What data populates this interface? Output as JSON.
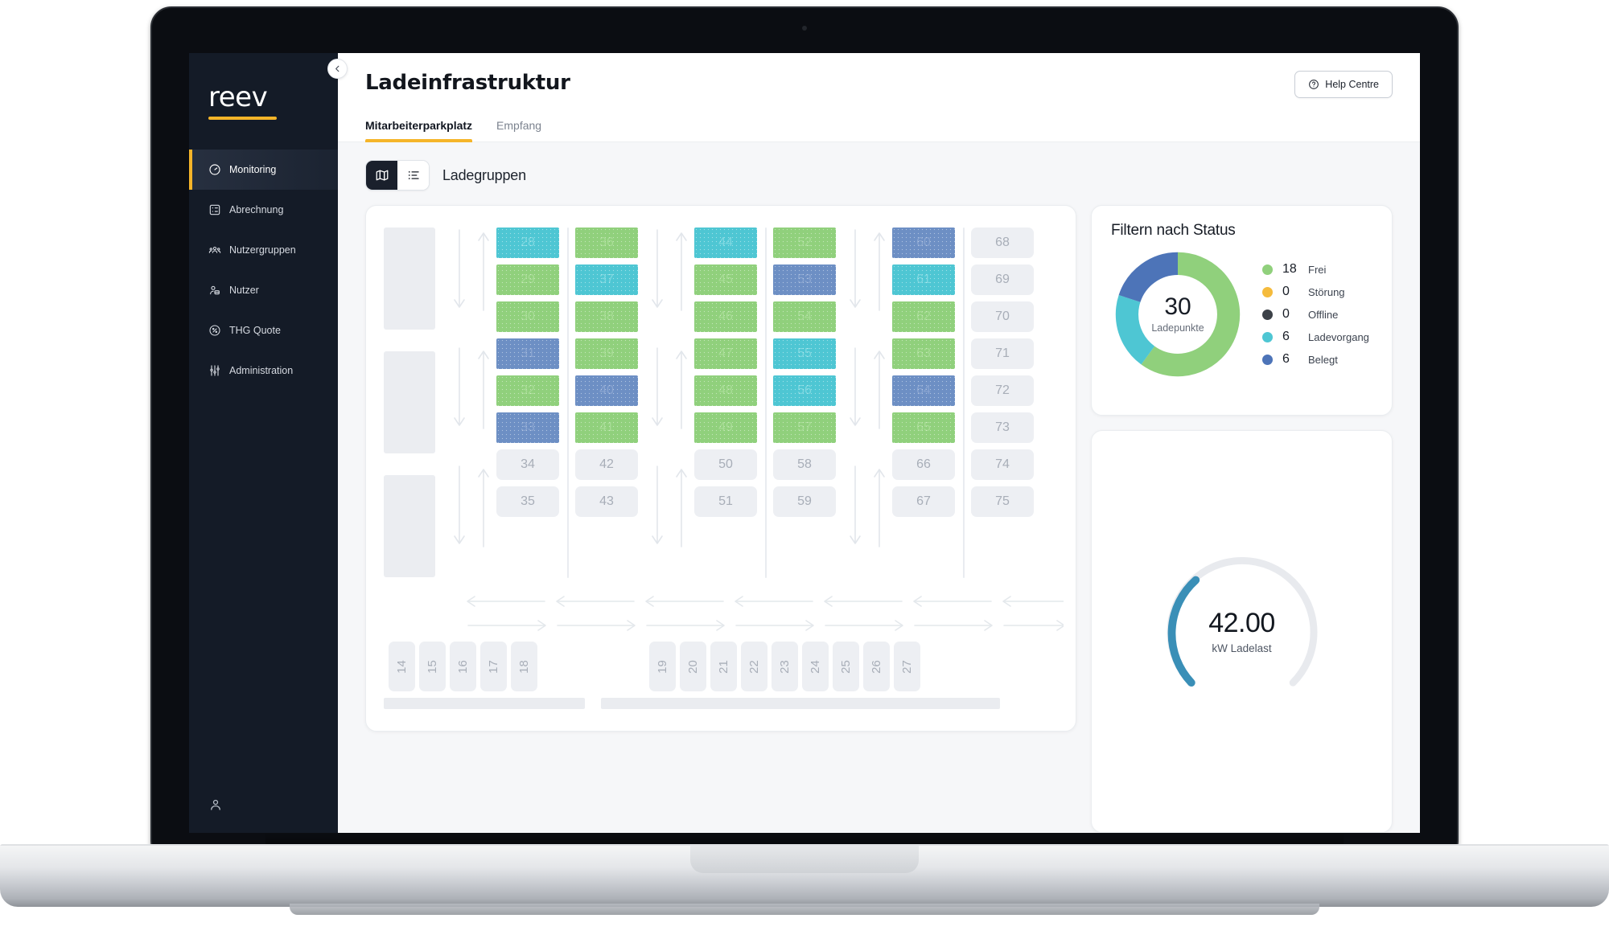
{
  "brand": {
    "wordmark": "reev"
  },
  "sidebar": {
    "items": [
      {
        "label": "Monitoring",
        "icon": "gauge-icon",
        "active": true
      },
      {
        "label": "Abrechnung",
        "icon": "receipt-icon",
        "active": false
      },
      {
        "label": "Nutzergruppen",
        "icon": "users-icon",
        "active": false
      },
      {
        "label": "Nutzer",
        "icon": "user-icon",
        "active": false
      },
      {
        "label": "THG Quote",
        "icon": "percent-icon",
        "active": false
      },
      {
        "label": "Administration",
        "icon": "sliders-icon",
        "active": false
      }
    ],
    "account_icon": "user-account-icon"
  },
  "header": {
    "title": "Ladeinfrastruktur",
    "help_label": "Help Centre",
    "help_icon": "question-circle-icon",
    "collapse_icon": "chevron-left-icon"
  },
  "tabs": [
    {
      "label": "Mitarbeiterparkplatz",
      "active": true
    },
    {
      "label": "Empfang",
      "active": false
    }
  ],
  "toolbar": {
    "title": "Ladegruppen",
    "views": [
      {
        "name": "map-view",
        "icon": "map-icon",
        "active": true
      },
      {
        "name": "list-view",
        "icon": "list-icon",
        "active": false
      }
    ]
  },
  "colors": {
    "free": "#90d07c",
    "stoerung": "#f5bb3c",
    "offline": "#3c4148",
    "charging": "#4ec6d3",
    "occupied": "#4d74b8",
    "empty": "#edeff3",
    "accent": "#f5b529",
    "gauge": "#3a8fb7",
    "gauge_track": "#e8eaee"
  },
  "map": {
    "slot_columns": [
      {
        "x": 162,
        "slots": [
          {
            "id": "28",
            "state": "charging"
          },
          {
            "id": "29",
            "state": "free"
          },
          {
            "id": "30",
            "state": "free"
          },
          {
            "id": "31",
            "state": "occupied"
          },
          {
            "id": "32",
            "state": "free"
          },
          {
            "id": "33",
            "state": "occupied"
          },
          {
            "id": "34",
            "state": "empty"
          },
          {
            "id": "35",
            "state": "empty"
          }
        ]
      },
      {
        "x": 260,
        "slots": [
          {
            "id": "36",
            "state": "free"
          },
          {
            "id": "37",
            "state": "charging"
          },
          {
            "id": "38",
            "state": "free"
          },
          {
            "id": "39",
            "state": "free"
          },
          {
            "id": "40",
            "state": "occupied"
          },
          {
            "id": "41",
            "state": "free"
          },
          {
            "id": "42",
            "state": "empty"
          },
          {
            "id": "43",
            "state": "empty"
          }
        ]
      },
      {
        "x": 408,
        "slots": [
          {
            "id": "44",
            "state": "charging"
          },
          {
            "id": "45",
            "state": "free"
          },
          {
            "id": "46",
            "state": "free"
          },
          {
            "id": "47",
            "state": "free"
          },
          {
            "id": "48",
            "state": "free"
          },
          {
            "id": "49",
            "state": "free"
          },
          {
            "id": "50",
            "state": "empty"
          },
          {
            "id": "51",
            "state": "empty"
          }
        ]
      },
      {
        "x": 506,
        "slots": [
          {
            "id": "52",
            "state": "free"
          },
          {
            "id": "53",
            "state": "occupied"
          },
          {
            "id": "54",
            "state": "free"
          },
          {
            "id": "55",
            "state": "charging"
          },
          {
            "id": "56",
            "state": "charging"
          },
          {
            "id": "57",
            "state": "free"
          },
          {
            "id": "58",
            "state": "empty"
          },
          {
            "id": "59",
            "state": "empty"
          }
        ]
      },
      {
        "x": 654,
        "slots": [
          {
            "id": "60",
            "state": "occupied"
          },
          {
            "id": "61",
            "state": "charging"
          },
          {
            "id": "62",
            "state": "free"
          },
          {
            "id": "63",
            "state": "free"
          },
          {
            "id": "64",
            "state": "occupied"
          },
          {
            "id": "65",
            "state": "free"
          },
          {
            "id": "66",
            "state": "empty"
          },
          {
            "id": "67",
            "state": "empty"
          }
        ]
      },
      {
        "x": 752,
        "slots": [
          {
            "id": "68",
            "state": "empty"
          },
          {
            "id": "69",
            "state": "empty"
          },
          {
            "id": "70",
            "state": "empty"
          },
          {
            "id": "71",
            "state": "empty"
          },
          {
            "id": "72",
            "state": "empty"
          },
          {
            "id": "73",
            "state": "empty"
          },
          {
            "id": "74",
            "state": "empty"
          },
          {
            "id": "75",
            "state": "empty"
          }
        ]
      }
    ],
    "bottom_groups": [
      {
        "x": 28,
        "slots": [
          "14",
          "15",
          "16",
          "17",
          "18"
        ]
      },
      {
        "x": 352,
        "slots": [
          "19",
          "20",
          "21",
          "22",
          "23",
          "24",
          "25",
          "26",
          "27"
        ]
      }
    ]
  },
  "status_panel": {
    "title": "Filtern nach Status",
    "total": "30",
    "total_label": "Ladepunkte",
    "legend": [
      {
        "count": "18",
        "label": "Frei",
        "color": "#90d07c"
      },
      {
        "count": "0",
        "label": "Störung",
        "color": "#f5bb3c"
      },
      {
        "count": "0",
        "label": "Offline",
        "color": "#3c4148"
      },
      {
        "count": "6",
        "label": "Ladevorgang",
        "color": "#4ec6d3"
      },
      {
        "count": "6",
        "label": "Belegt",
        "color": "#4d74b8"
      }
    ]
  },
  "gauge_panel": {
    "value": "42.00",
    "unit": "kW Ladelast"
  },
  "chart_data": [
    {
      "type": "pie",
      "title": "Filtern nach Status",
      "subtitle": "30 Ladepunkte",
      "categories": [
        "Frei",
        "Störung",
        "Offline",
        "Ladevorgang",
        "Belegt"
      ],
      "values": [
        18,
        0,
        0,
        6,
        6
      ],
      "colors": [
        "#90d07c",
        "#f5bb3c",
        "#3c4148",
        "#4ec6d3",
        "#4d74b8"
      ],
      "total": 30,
      "legend": "right",
      "donut": true
    },
    {
      "type": "gauge",
      "title": "kW Ladelast",
      "value": 42.0,
      "ylim": [
        0,
        100
      ],
      "unit": "kW",
      "color": "#3a8fb7",
      "track_color": "#e8eaee"
    }
  ]
}
